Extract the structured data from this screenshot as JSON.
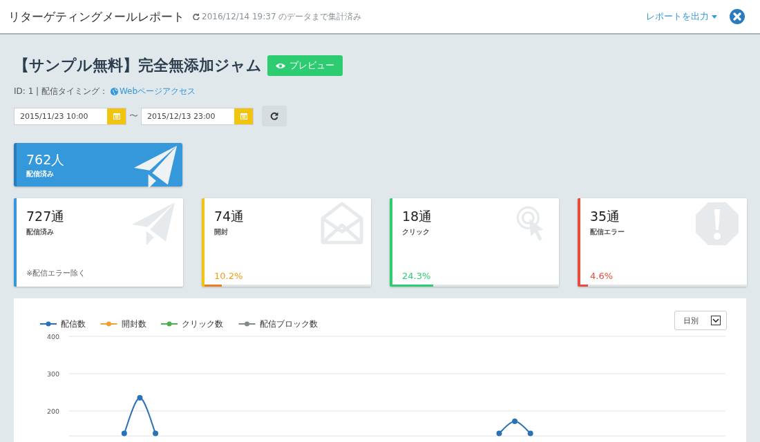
{
  "header": {
    "title": "リターゲティングメールレポート",
    "updated": "2016/12/14 19:37 のデータまで集計済み",
    "export_menu": "レポートを出力"
  },
  "campaign": {
    "title": "【サンプル無料】完全無添加ジャム",
    "preview_button": "プレビュー",
    "meta": "ID: 1 | 配信タイミング：",
    "timing_link": "Webページアクセス"
  },
  "date_range": {
    "from": "2015/11/23 10:00",
    "separator": "〜",
    "to": "2015/12/13 23:00"
  },
  "summary": {
    "count": "762人",
    "label": "配信済み"
  },
  "cards": [
    {
      "kind": "delivered",
      "color": "#3498db",
      "count": "727通",
      "label": "配信済み",
      "note": "※配信エラー除く"
    },
    {
      "kind": "opened",
      "color": "#f1c40f",
      "count": "74通",
      "label": "開封",
      "rate": "10.2%",
      "level": 0.102
    },
    {
      "kind": "clicked",
      "color": "#2ecc71",
      "count": "18通",
      "label": "クリック",
      "rate": "24.3%",
      "level": 0.243
    },
    {
      "kind": "error",
      "color": "#e74c3c",
      "count": "35通",
      "label": "配信エラー",
      "rate": "4.6%",
      "level": 0.046
    }
  ],
  "chart_panel": {
    "period_select": "日別",
    "chart_data": {
      "type": "line",
      "ylim": [
        131,
        400
      ],
      "yticks": [
        200,
        300,
        400
      ],
      "series": [
        {
          "name": "配信数",
          "color": "#2a72b5",
          "marker": "circle",
          "values": [
            null,
            null,
            null,
            140,
            235,
            140,
            null,
            null,
            null,
            null,
            null,
            null,
            null,
            null,
            null,
            null,
            null,
            null,
            null,
            null,
            null,
            null,
            null,
            null,
            null,
            null,
            null,
            140,
            172,
            140,
            null,
            null,
            null,
            null,
            null,
            null,
            null,
            null,
            null,
            null,
            null,
            null
          ]
        },
        {
          "name": "開封数",
          "color": "#f0a030",
          "values": [
            null,
            null,
            null
          ]
        },
        {
          "name": "クリック数",
          "color": "#4cb050",
          "values": [
            null,
            null,
            null
          ]
        },
        {
          "name": "配信ブロック数",
          "color": "#7f8c8d",
          "values": [
            null,
            null,
            null
          ]
        }
      ]
    }
  }
}
